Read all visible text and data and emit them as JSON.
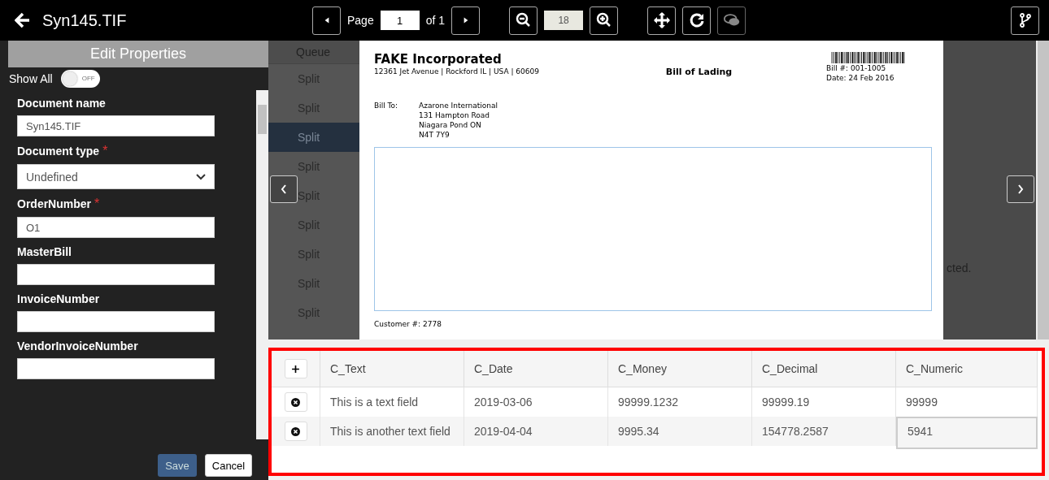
{
  "window": {
    "title": "Syn145.TIF"
  },
  "toolbar": {
    "page_label": "Page",
    "page": "1",
    "of_label": "of 1",
    "zoom": "18",
    "comments_disabled": true
  },
  "panel": {
    "title": "Edit Properties",
    "show_all_label": "Show All",
    "show_all": {
      "on": false,
      "label": "OFF"
    },
    "required_mark": "*",
    "fields": [
      {
        "kind": "text",
        "label": "Document name",
        "required": false,
        "value": "Syn145.TIF"
      },
      {
        "kind": "select",
        "label": "Document type",
        "required": true,
        "value": "Undefined"
      },
      {
        "kind": "text",
        "label": "OrderNumber",
        "required": true,
        "value": "O1"
      },
      {
        "kind": "text",
        "label": "MasterBill",
        "required": false
      },
      {
        "kind": "text",
        "label": "InvoiceNumber",
        "required": false
      },
      {
        "kind": "text",
        "label": "VendorInvoiceNumber",
        "required": false
      }
    ],
    "save": "Save",
    "cancel": "Cancel"
  },
  "background_list": {
    "header": "Queue",
    "rows": [
      "Split",
      "Split",
      "Split",
      "Split",
      "Split",
      "Split",
      "Split",
      "Split",
      "Split"
    ],
    "fragment": "cted."
  },
  "document": {
    "company": "FAKE Incorporated",
    "address": "12361 Jet Avenue | Rockford IL | USA | 60609",
    "title": "Bill of Lading",
    "bill_no": "Bill #: 001-1005",
    "date": "Date: 24 Feb 2016",
    "bill_to_label": "Bill To:",
    "bill_to": [
      "Azarone International",
      "131 Hampton Road",
      "Niagara Pond ON",
      "N4T 7Y9"
    ],
    "customer": "Customer #: 2778"
  },
  "table": {
    "columns": [
      "C_Text",
      "C_Date",
      "C_Money",
      "C_Decimal",
      "C_Numeric"
    ],
    "rows": [
      {
        "cells": [
          "This is a text field",
          "2019-03-06",
          "99999.1232",
          "99999.19",
          "99999"
        ]
      },
      {
        "cells": [
          "This is another text field",
          "2019-04-04",
          "9995.34",
          "154778.2587",
          "5941"
        ]
      }
    ]
  }
}
